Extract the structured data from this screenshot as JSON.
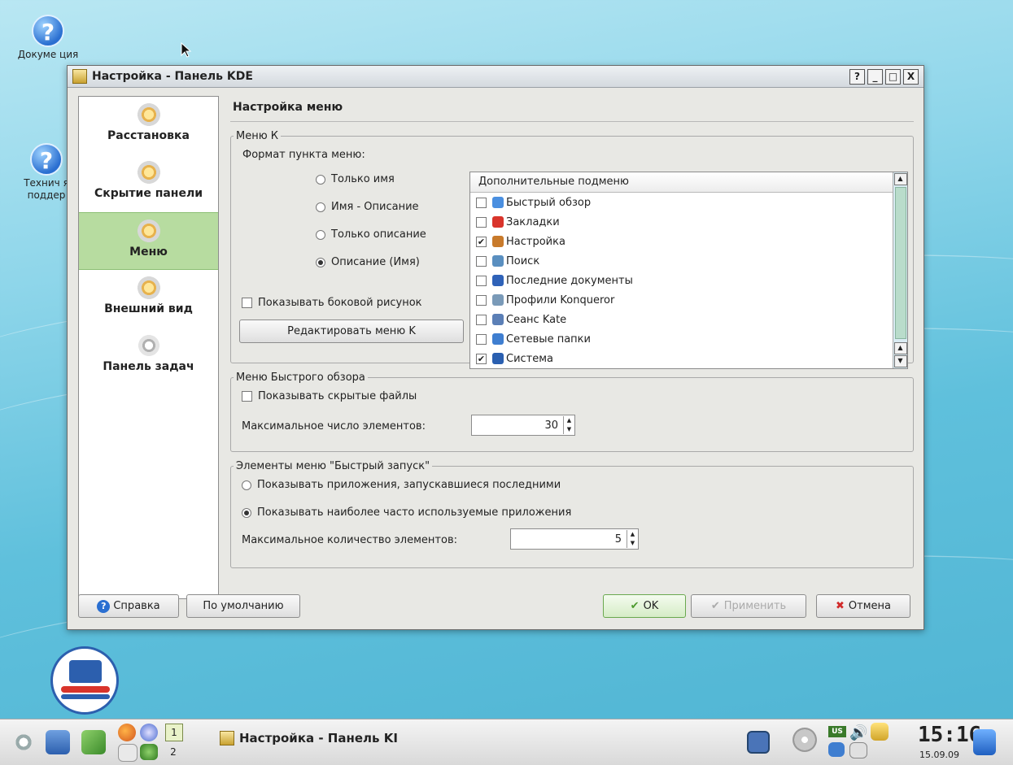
{
  "desktop": {
    "icons": [
      {
        "label": "Докуме ция"
      },
      {
        "label": "Технич я поддер"
      }
    ]
  },
  "window": {
    "title": "Настройка - Панель KDE",
    "buttons": [
      "?",
      "_",
      "□",
      "X"
    ]
  },
  "sidebar": {
    "items": [
      {
        "label": "Расстановка"
      },
      {
        "label": "Скрытие панели"
      },
      {
        "label": "Меню"
      },
      {
        "label": "Внешний вид"
      },
      {
        "label": "Панель задач"
      }
    ]
  },
  "main": {
    "page_title": "Настройка меню",
    "k_menu": {
      "legend": "Меню К",
      "format_label": "Формат пункта меню:",
      "options": [
        "Только имя",
        "Имя - Описание",
        "Только описание",
        "Описание (Имя)"
      ],
      "selected_option": "Описание (Имя)",
      "side_image_label": "Показывать боковой рисунок",
      "edit_button": "Редактировать меню K",
      "submenus_header": "Дополнительные подменю",
      "submenus": [
        {
          "label": "Быстрый обзор",
          "checked": false,
          "color": "#4a8fe0"
        },
        {
          "label": "Закладки",
          "checked": false,
          "color": "#d9342b"
        },
        {
          "label": "Настройка",
          "checked": true,
          "color": "#c87a2b"
        },
        {
          "label": "Поиск",
          "checked": false,
          "color": "#5a8fc0"
        },
        {
          "label": "Последние документы",
          "checked": false,
          "color": "#2f62b8"
        },
        {
          "label": "Профили Konqueror",
          "checked": false,
          "color": "#7a9ab8"
        },
        {
          "label": "Сеанс Kate",
          "checked": false,
          "color": "#5b7fb6"
        },
        {
          "label": "Сетевые папки",
          "checked": false,
          "color": "#3f7ed0"
        },
        {
          "label": "Система",
          "checked": true,
          "color": "#2a5fb0"
        }
      ]
    },
    "quick_browser": {
      "legend": "Меню Быстрого обзора",
      "hidden_files_label": "Показывать скрытые файлы",
      "max_label": "Максимальное число элементов:",
      "max_value": "30"
    },
    "quick_start": {
      "legend": "Элементы меню \"Быстрый запуск\"",
      "option_recent": "Показывать приложения, запускавшиеся последними",
      "option_frequent": "Показывать наиболее часто используемые приложения",
      "max_label": "Максимальное количество элементов:",
      "max_value": "5"
    }
  },
  "footer": {
    "help": "Справка",
    "defaults": "По умолчанию",
    "ok": "OK",
    "apply": "Применить",
    "cancel": "Отмена"
  },
  "taskbar": {
    "desk_number_1": "1",
    "desk_number_2": "2",
    "task_title": "Настройка - Панель KI",
    "kbd_layout": "US",
    "clock": "15:16",
    "date": "15.09.09"
  },
  "colors": {
    "selection": "#b7dca0",
    "desktop": "#5fc0dc"
  }
}
